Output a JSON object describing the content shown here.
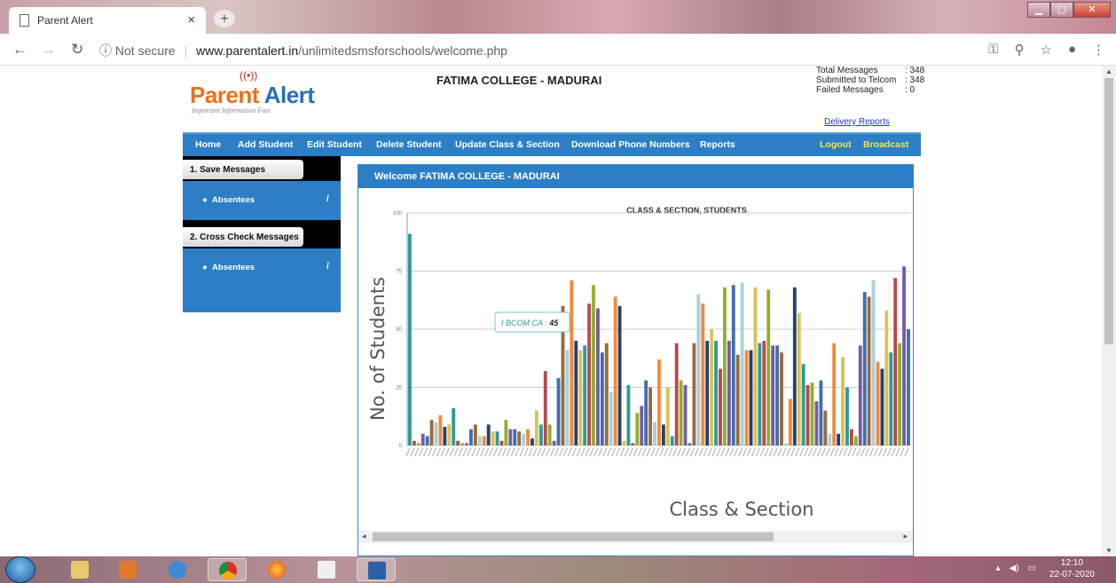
{
  "browser": {
    "tab_title": "Parent Alert",
    "tab_close": "×",
    "new_tab": "+",
    "security": "Not secure",
    "url_domain": "www.parentalert.in",
    "url_path": "/unlimitedsmsforschools/welcome.php"
  },
  "header": {
    "logo_main": "Parent",
    "logo_second": "Alert",
    "logo_tagline": "Important Information Fast",
    "college": "FATIMA COLLEGE - MADURAI",
    "stats": [
      {
        "label": "Total Messages",
        "value": ": 348"
      },
      {
        "label": "Submitted to Telcom",
        "value": ": 348"
      },
      {
        "label": "Failed Messages",
        "value": ": 0"
      }
    ],
    "delivery_link": "Delivery Reports"
  },
  "menu": {
    "home": "Home",
    "add_student": "Add Student",
    "edit_student": "Edit Student",
    "delete_student": "Delete Student",
    "update_class": "Update Class & Section",
    "download_phone": "Download Phone Numbers",
    "reports": "Reports",
    "logout": "Logout",
    "broadcast": "Broadcast"
  },
  "sidebar": {
    "section1": "1. Save Messages",
    "section1_item": "Absentees",
    "section2": "2. Cross Check Messages",
    "section2_item": "Absentees",
    "slash": "/"
  },
  "panel": {
    "title": "Welcome FATIMA COLLEGE - MADURAI"
  },
  "colors": {
    "menu_blue": "#2c7fc4",
    "bar_palette": [
      "#2e9a9a",
      "#b84a4a",
      "#8fb12c",
      "#7a5aa0",
      "#3f6fb0",
      "#9a6a3a",
      "#a8d0dc",
      "#f08a3a",
      "#2a3f6a",
      "#d9c25a"
    ]
  },
  "chart_data": {
    "type": "bar",
    "title": "CLASS & SECTION, STUDENTS",
    "xlabel": "Class & Section",
    "ylabel": "No. of Students",
    "ylim": [
      0,
      100
    ],
    "yticks": [
      0,
      25,
      50,
      75,
      100
    ],
    "grid": true,
    "tooltip": {
      "label": "I BCOM CA",
      "value": "45"
    },
    "values": [
      91,
      2,
      1,
      5,
      4,
      11,
      10,
      13,
      8,
      9,
      16,
      2,
      1,
      1,
      7,
      9,
      4,
      4,
      9,
      6,
      6,
      2,
      11,
      7,
      7,
      6,
      5,
      7,
      3,
      15,
      9,
      32,
      9,
      2,
      29,
      60,
      41,
      71,
      45,
      41,
      43,
      61,
      69,
      59,
      40,
      44,
      23,
      64,
      60,
      2,
      26,
      1,
      14,
      17,
      28,
      25,
      10,
      37,
      9,
      25,
      4,
      44,
      28,
      26,
      1,
      44,
      65,
      61,
      45,
      50,
      45,
      33,
      68,
      45,
      69,
      39,
      70,
      41,
      41,
      68,
      44,
      45,
      67,
      43,
      43,
      40,
      1,
      20,
      68,
      57,
      35,
      26,
      27,
      19,
      28,
      15,
      5,
      44,
      5,
      38,
      25,
      7,
      4,
      43,
      66,
      64,
      71,
      36,
      33,
      58,
      40,
      72,
      44,
      77,
      50
    ]
  },
  "taskbar": {
    "time": "12:10",
    "date": "22-07-2020"
  }
}
